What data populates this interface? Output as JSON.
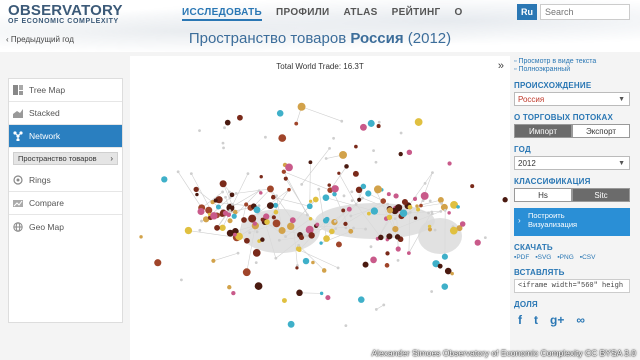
{
  "header": {
    "logo_main": "OBSERVATORY",
    "logo_sub": "OF ECONOMIC COMPLEXITY",
    "nav": [
      {
        "label": "ИССЛЕДОВАТЬ",
        "active": true
      },
      {
        "label": "ПРОФИЛИ",
        "active": false
      },
      {
        "label": "ATLAS",
        "active": false
      },
      {
        "label": "РЕЙТИНГ",
        "active": false
      },
      {
        "label": "О",
        "active": false
      }
    ],
    "lang": "Ru",
    "search_placeholder": "Search"
  },
  "back_link": "‹ Предыдущий год",
  "title": {
    "prefix": "Пространство товаров ",
    "country": "Россия",
    "year": " (2012)"
  },
  "sidebar": {
    "items": [
      {
        "label": "Tree Map",
        "icon": "treemap-icon"
      },
      {
        "label": "Stacked",
        "icon": "stacked-icon"
      },
      {
        "label": "Network",
        "icon": "network-icon",
        "active": true
      },
      {
        "label": "Rings",
        "icon": "rings-icon"
      },
      {
        "label": "Compare",
        "icon": "compare-icon"
      },
      {
        "label": "Geo Map",
        "icon": "geomap-icon"
      }
    ],
    "sub_item": "Пространство товаров"
  },
  "main": {
    "total_trade": "Total World Trade: 16.3T",
    "expand_label": "»"
  },
  "right": {
    "link_text": "Просмотр в виде текста",
    "link_fullscreen": "Полноэкранный",
    "origin_label": "ПРОИСХОЖДЕНИЕ",
    "origin_value": "Россия",
    "flow_label": "О ТОРГОВЫХ ПОТОКАХ",
    "flow_options": [
      "Импорт",
      "Экспорт"
    ],
    "year_label": "ГОД",
    "year_value": "2012",
    "class_label": "КЛАССИФИКАЦИЯ",
    "class_options": [
      "Hs",
      "Sitc"
    ],
    "build_line1": "Построить",
    "build_line2": "Визуализация",
    "download_label": "СКАЧАТЬ",
    "download_formats": [
      "PDF",
      "SVG",
      "PNG",
      "CSV"
    ],
    "embed_label": "ВСТАВЛЯТЬ",
    "embed_code": "<iframe width=\"560\" heigh",
    "share_label": "ДОЛЯ",
    "share_icons": [
      "f",
      "t",
      "g+",
      "∞"
    ]
  },
  "credit": "Alexander Simoes Observatory of Economic Complexity CC BYSA 3.0",
  "colors": {
    "accent": "#2a77b4",
    "active_bg": "#2a7fc0",
    "network_edge": "#cfcfcf"
  }
}
